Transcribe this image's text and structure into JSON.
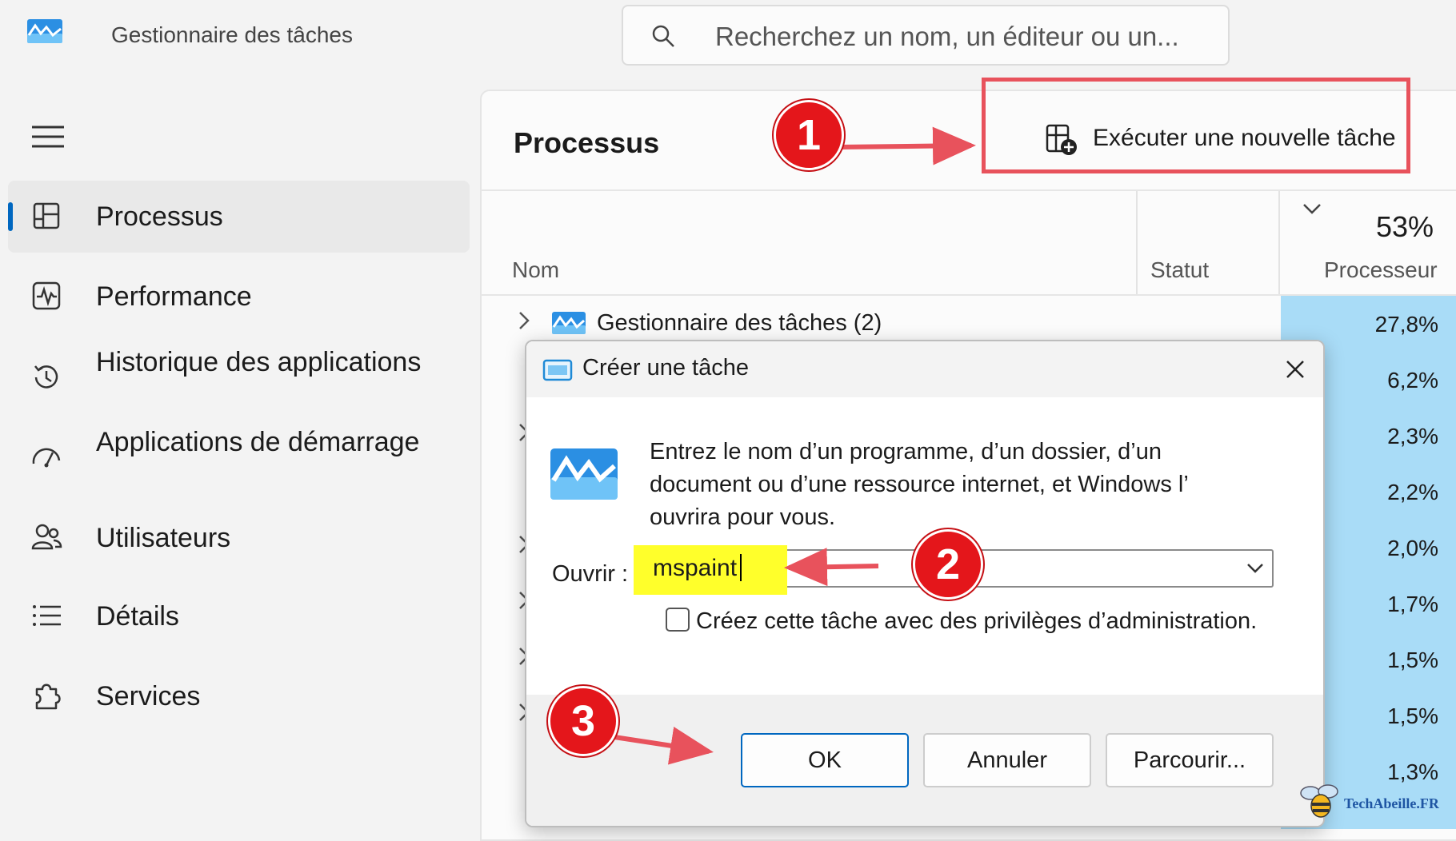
{
  "app": {
    "title": "Gestionnaire des tâches",
    "search_placeholder": "Recherchez un nom, un éditeur ou un..."
  },
  "sidebar": {
    "items": [
      {
        "label": "Processus",
        "icon": "processes-grid-icon",
        "active": true
      },
      {
        "label": "Performance",
        "icon": "performance-pulse-icon"
      },
      {
        "label": "Historique des applications",
        "icon": "history-clock-icon"
      },
      {
        "label": "Applications de démarrage",
        "icon": "startup-speedometer-icon"
      },
      {
        "label": "Utilisateurs",
        "icon": "users-icon"
      },
      {
        "label": "Détails",
        "icon": "details-list-icon"
      },
      {
        "label": "Services",
        "icon": "services-puzzle-icon"
      }
    ]
  },
  "main": {
    "title": "Processus",
    "run_task_label": "Exécuter une nouvelle tâche",
    "columns": {
      "name": "Nom",
      "status": "Statut",
      "cpu": "Processeur",
      "cpu_total": "53%"
    },
    "rows": [
      {
        "name": "Gestionnaire des tâches (2)",
        "cpu": "27,8%"
      },
      {
        "name": "",
        "cpu": "6,2%"
      },
      {
        "name": "",
        "cpu": "2,3%"
      },
      {
        "name": "",
        "cpu": "2,2%"
      },
      {
        "name": "",
        "cpu": "2,0%"
      },
      {
        "name": "",
        "cpu": "1,7%"
      },
      {
        "name": "",
        "cpu": "1,5%"
      },
      {
        "name": "",
        "cpu": "1,5%"
      },
      {
        "name": "",
        "cpu": "1,3%"
      }
    ]
  },
  "dialog": {
    "title": "Créer une tâche",
    "message": "Entrez le nom d’un programme, d’un dossier, d’un document ou d’une ressource internet, et Windows l’ ouvrira pour vous.",
    "open_label": "Ouvrir :",
    "open_value": "mspaint",
    "admin_checkbox_label": "Créez cette tâche avec des privilèges d’administration.",
    "admin_checked": false,
    "ok_label": "OK",
    "cancel_label": "Annuler",
    "browse_label": "Parcourir..."
  },
  "annotations": {
    "step1": "1",
    "step2": "2",
    "step3": "3",
    "color": "#e4161b"
  },
  "watermark": {
    "text": "TechAbeille.FR"
  },
  "colors": {
    "accent": "#0067c0",
    "cpu_heat": "#a9dcf7",
    "highlight": "#ffff2b",
    "callout": "#e8525c"
  }
}
